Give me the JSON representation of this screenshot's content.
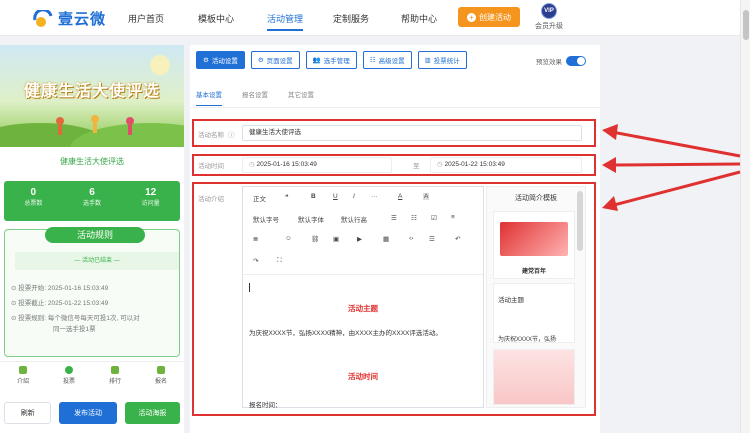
{
  "brand": {
    "name": "壹云微"
  },
  "nav": {
    "items": [
      "用户首页",
      "模板中心",
      "活动管理",
      "定制服务",
      "帮助中心"
    ],
    "active": "活动管理",
    "create_label": "创建活动",
    "vip_badge": "VIP",
    "vip_label": "会员升级"
  },
  "preview": {
    "banner_title": "健康生活大使评选",
    "event_name": "健康生活大使评选",
    "stats": [
      {
        "value": "0",
        "label": "总票数"
      },
      {
        "value": "6",
        "label": "选手数"
      },
      {
        "value": "12",
        "label": "访问量"
      }
    ],
    "rules_title": "活动规则",
    "rules_status": "— 活动已结束 —",
    "rules": [
      "投票开始: 2025-01-16 15:03:49",
      "投票截止: 2025-01-22 15:03:49",
      "投票规则: 每个微信号每天可投1次, 可以对",
      "同一选手投1票"
    ],
    "tabs": [
      "介绍",
      "投票",
      "排行",
      "报名"
    ],
    "buttons": {
      "refresh": "刷新",
      "publish": "发布活动",
      "poster": "活动海报"
    }
  },
  "toolbar": {
    "buttons": [
      "活动设置",
      "页面设置",
      "选手管理",
      "高级设置",
      "投票统计"
    ],
    "preview_label": "预览效果"
  },
  "subtabs": [
    "基本设置",
    "报名设置",
    "其它设置"
  ],
  "form": {
    "name_label": "活动名称",
    "name_value": "健康生活大使评选",
    "time_label": "活动时间",
    "start": "2025-01-16 15:03:49",
    "sep": "至",
    "end": "2025-01-22 15:03:49",
    "intro_label": "活动介绍"
  },
  "editor": {
    "toolbar_row1": [
      "正文",
      "❝",
      "B",
      "U",
      "I",
      "···",
      "A",
      "A"
    ],
    "toolbar_row2": [
      "默认字号",
      "默认字体",
      "默认行高",
      "☰",
      "☷",
      "☑",
      "≡"
    ],
    "toolbar_row3": [
      "≣",
      "☺",
      "⛓",
      "▣",
      "▶",
      "▦",
      "‹›",
      "☲",
      "↶"
    ],
    "toolbar_row4": [
      "↷",
      "⛶"
    ],
    "heading1": "活动主题",
    "paragraph1": "为庆祝XXXX节，弘扬XXXX精神，由XXXX主办的XXXX评选活动。",
    "heading2": "活动时间",
    "paragraph2": "报名时间："
  },
  "template_panel": {
    "title": "活动简介模板",
    "card1_caption": "建党百年",
    "card2_title": "活动主题",
    "card2_text": "为庆祝XXXX节，弘扬"
  },
  "colors": {
    "accent": "#1f6fd6",
    "green": "#3ab24b",
    "orange": "#f5951e",
    "red": "#e03131"
  }
}
